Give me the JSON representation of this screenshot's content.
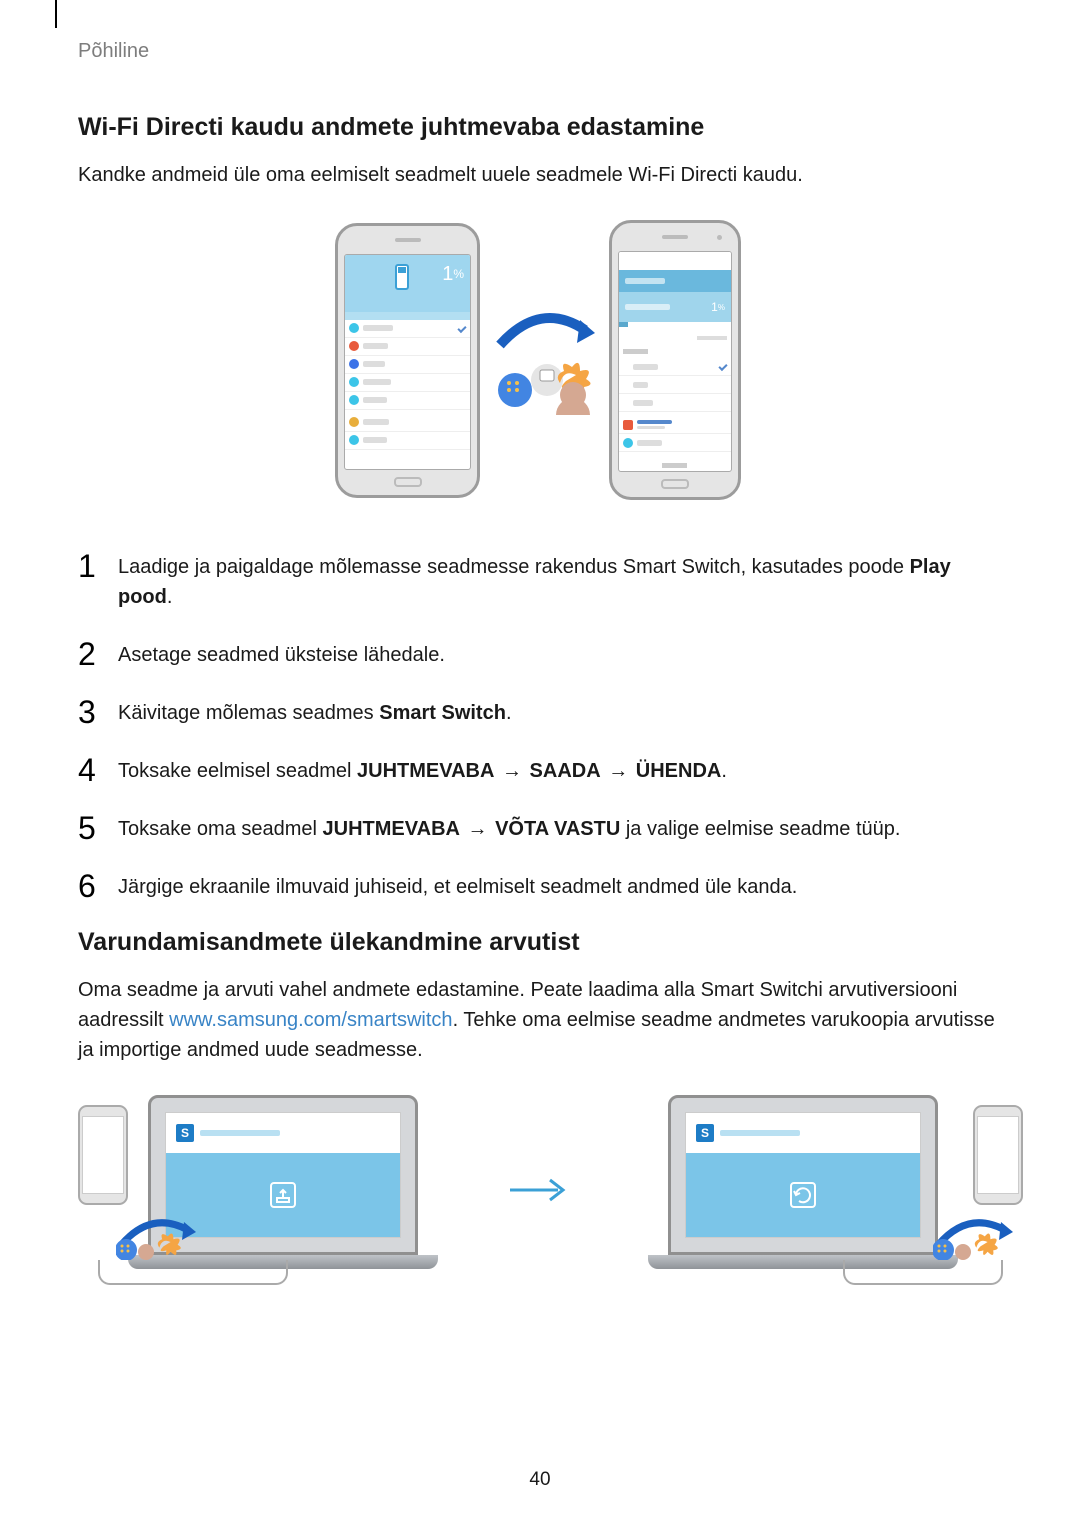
{
  "breadcrumb": "Põhiline",
  "section1": {
    "title": "Wi-Fi Directi kaudu andmete juhtmevaba edastamine",
    "intro": "Kandke andmeid üle oma eelmiselt seadmelt uuele seadmele Wi-Fi Directi kaudu."
  },
  "phone_percent": "1",
  "percent_sym": "%",
  "steps": [
    {
      "num": "1",
      "prefix": "Laadige ja paigaldage mõlemasse seadmesse rakendus Smart Switch, kasutades poode ",
      "bold": "Play pood",
      "suffix": "."
    },
    {
      "num": "2",
      "prefix": "Asetage seadmed üksteise lähedale.",
      "bold": "",
      "suffix": ""
    },
    {
      "num": "3",
      "prefix": "Käivitage mõlemas seadmes ",
      "bold": "Smart Switch",
      "suffix": "."
    },
    {
      "num": "4",
      "prefix": "Toksake eelmisel seadmel ",
      "bold": "JUHTMEVABA",
      "arrow1": " → ",
      "bold2": "SAADA",
      "arrow2": " → ",
      "bold3": "ÜHENDA",
      "suffix": "."
    },
    {
      "num": "5",
      "prefix": "Toksake oma seadmel ",
      "bold": "JUHTMEVABA",
      "arrow1": " → ",
      "bold2": "VÕTA VASTU",
      "suffix2": " ja valige eelmise seadme tüüp."
    },
    {
      "num": "6",
      "prefix": "Järgige ekraanile ilmuvaid juhiseid, et eelmiselt seadmelt andmed üle kanda.",
      "bold": "",
      "suffix": ""
    }
  ],
  "section2": {
    "title": "Varundamisandmete ülekandmine arvutist",
    "para_before": "Oma seadme ja arvuti vahel andmete edastamine. Peate laadima alla Smart Switchi arvutiversiooni aadressilt ",
    "link": "www.samsung.com/smartswitch",
    "para_after": ". Tehke oma eelmise seadme andmetes varukoopia arvutisse ja importige andmed uude seadmesse."
  },
  "laptop_s": "S",
  "page_number": "40"
}
